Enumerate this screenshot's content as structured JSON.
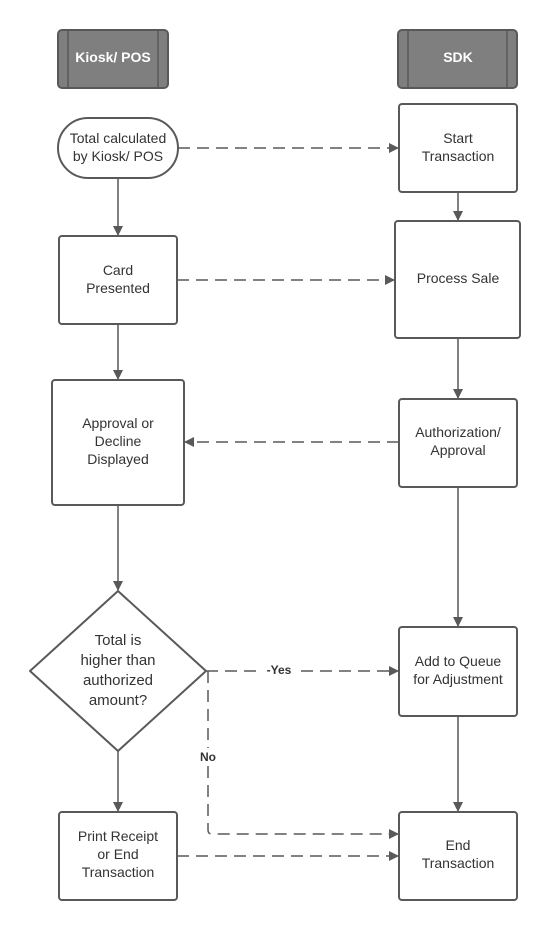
{
  "lanes": {
    "left": "Kiosk/ POS",
    "right": "SDK"
  },
  "nodes": {
    "total_calculated": [
      "Total calculated",
      "by Kiosk/ POS"
    ],
    "card_presented": [
      "Card",
      "Presented"
    ],
    "approval_displayed": [
      "Approval or",
      "Decline",
      "Displayed"
    ],
    "decision": [
      "Total is",
      "higher than",
      "authorized",
      "amount?"
    ],
    "print_receipt": [
      "Print Receipt",
      "or End",
      "Transaction"
    ],
    "start_transaction": [
      "Start",
      "Transaction"
    ],
    "process_sale": [
      "Process Sale"
    ],
    "authorization": [
      "Authorization/",
      "Approval"
    ],
    "add_to_queue": [
      "Add to Queue",
      "for Adjustment"
    ],
    "end_transaction": [
      "End",
      "Transaction"
    ]
  },
  "edge_labels": {
    "yes": "-Yes",
    "no": "No"
  },
  "colors": {
    "header_fill": "#7f7f7f",
    "stroke": "#595959",
    "text": "#333333"
  }
}
